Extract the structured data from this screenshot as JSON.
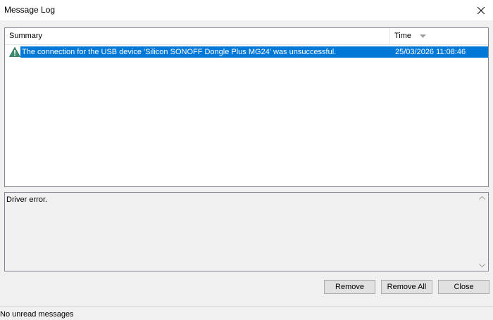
{
  "window": {
    "title": "Message Log"
  },
  "list": {
    "columns": {
      "summary": "Summary",
      "time": "Time"
    },
    "rows": [
      {
        "icon": "warning-icon",
        "summary": "The connection for the USB device 'Silicon SONOFF Dongle Plus MG24' was unsuccessful.",
        "time": "25/03/2026 11:08:46",
        "selected": true
      }
    ]
  },
  "detail": {
    "text": "Driver error."
  },
  "buttons": {
    "remove": "Remove",
    "remove_all": "Remove All",
    "close": "Close"
  },
  "status": {
    "text": "No unread messages"
  },
  "colors": {
    "selection": "#0078d7",
    "warning_icon": "#3c8c6e"
  }
}
